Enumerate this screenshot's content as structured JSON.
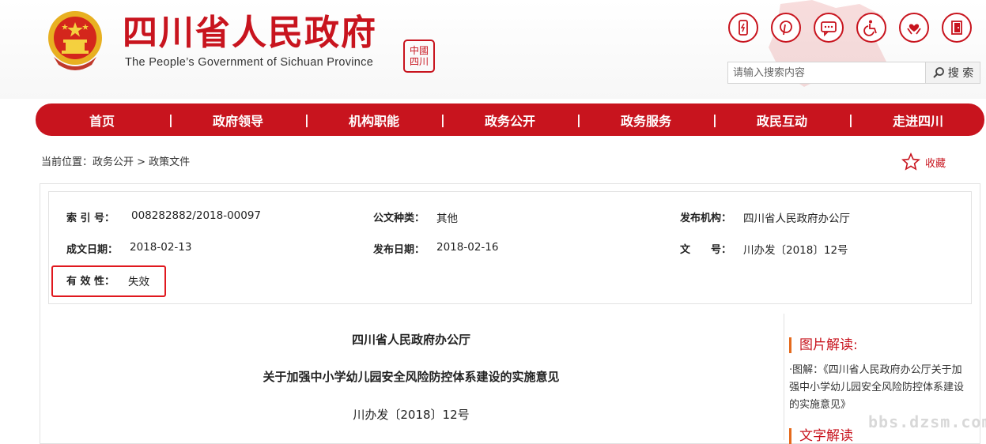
{
  "header": {
    "title": "四川省人民政府",
    "subtitle": "The People’s Government of Sichuan Province",
    "seal_text": "中國四川",
    "search_placeholder": "请输入搜索内容",
    "search_button": "搜 索",
    "tools": [
      "phone-icon",
      "pinterest-icon",
      "message-icon",
      "wheelchair-icon",
      "hands-heart-icon",
      "exit-icon"
    ]
  },
  "nav": {
    "items": [
      "首页",
      "政府领导",
      "机构职能",
      "政务公开",
      "政务服务",
      "政民互动",
      "走进四川"
    ],
    "separator": "|"
  },
  "breadcrumb": "当前位置：政务公开 > 政策文件",
  "bookmark": "收藏",
  "meta": {
    "index_label": "索 引 号：",
    "index_value": "008282882/2018-00097",
    "category_label": "公文种类：",
    "category_value": "其他",
    "issuer_label": "发布机构：",
    "issuer_value": "四川省人民政府办公厅",
    "created_label": "成文日期：",
    "created_value": "2018-02-13",
    "published_label": "发布日期：",
    "published_value": "2018-02-16",
    "docno_label": "文　　号：",
    "docno_value": "川办发〔2018〕12号",
    "validity_label": "有 效 性：",
    "validity_value": "失效"
  },
  "article": {
    "issuer": "四川省人民政府办公厅",
    "title": "关于加强中小学幼儿园安全风险防控体系建设的实施意见",
    "doc_number": "川办发〔2018〕12号"
  },
  "sidebar": {
    "heading": "图片解读:",
    "item": "·图解：《四川省人民政府办公厅关于加强中小学幼儿园安全风险防控体系建设的实施意见》",
    "heading2": "文字解读"
  },
  "watermark": "bbs.dzsm.com",
  "colors": {
    "brand_red": "#c8141e",
    "accent_orange": "#e56a1d",
    "highlight_red": "#e0181e"
  }
}
